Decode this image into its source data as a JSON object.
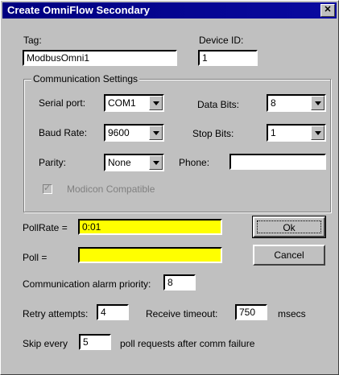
{
  "window": {
    "title": "Create OmniFlow Secondary",
    "close_glyph": "✕"
  },
  "tag": {
    "label": "Tag:",
    "value": "ModbusOmni1"
  },
  "device_id": {
    "label": "Device ID:",
    "value": "1"
  },
  "comm_settings": {
    "title": "Communication Settings",
    "serial_port": {
      "label": "Serial port:",
      "value": "COM1"
    },
    "data_bits": {
      "label": "Data Bits:",
      "value": "8"
    },
    "baud_rate": {
      "label": "Baud Rate:",
      "value": "9600"
    },
    "stop_bits": {
      "label": "Stop Bits:",
      "value": "1"
    },
    "parity": {
      "label": "Parity:",
      "value": "None"
    },
    "phone": {
      "label": "Phone:",
      "value": ""
    },
    "modicon": {
      "label": "Modicon Compatible",
      "checked": true,
      "enabled": false
    }
  },
  "pollrate": {
    "label": "PollRate =",
    "value": "0:01"
  },
  "poll": {
    "label": "Poll =",
    "value": ""
  },
  "buttons": {
    "ok": "Ok",
    "cancel": "Cancel"
  },
  "alarm_priority": {
    "label": "Communication alarm priority:",
    "value": "8"
  },
  "retry": {
    "label": "Retry attempts:",
    "value": "4"
  },
  "receive_timeout": {
    "label": "Receive timeout:",
    "value": "750",
    "unit": "msecs"
  },
  "skip": {
    "label_before": "Skip every",
    "value": "5",
    "label_after": "poll requests after comm failure"
  },
  "colors": {
    "titlebar": "#000080",
    "face": "#c0c0c0",
    "highlight_field": "#ffff00"
  }
}
